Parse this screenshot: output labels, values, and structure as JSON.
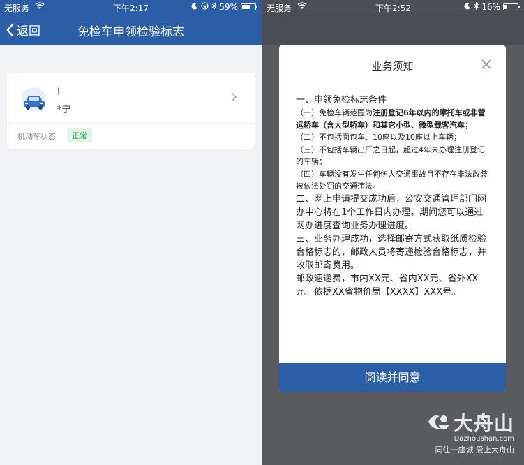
{
  "left": {
    "status_bar": {
      "carrier": "无服务",
      "time": "下午2:17",
      "battery": "59%",
      "battery_level": 0.59
    },
    "nav": {
      "back_label": "返回",
      "title": "免检车申领检验标志"
    },
    "vehicle_card": {
      "plate_line1": "I",
      "plate_line2": "*宁",
      "status_label": "机动车状态",
      "status_value": "正常"
    }
  },
  "right": {
    "status_bar": {
      "carrier": "无服务",
      "time": "下午2:52",
      "battery": "16%",
      "battery_level": 0.16
    },
    "modal": {
      "title": "业务须知",
      "heading1": "一、申领免检标志条件",
      "item1_a": "（一）免检车辆范围为",
      "item1_b": "注册登记6年以内的摩托车或非营运轿车（含大型轿车）和其它小型、微型载客汽车",
      "item1_c": "；",
      "item2": "（二）不包括面包车、10座以及10座以上车辆；",
      "item3": "（三）不包括车辆出厂之日起，超过4年未办理注册登记的车辆；",
      "item4": "（四）车辆没有发生任何伤人交通事故且不存在非法改装被依法处罚的交通违法。",
      "heading2": "二、网上申请提交成功后，公安交通管理部门网办中心将在1个工作日内办理，期间您可以通过网办进度查询业务办理进度。",
      "heading3": "三、业务办理成功，选择邮寄方式获取纸质检验合格标志的，邮政人员将寄递检验合格标志，并收取邮寄费用。",
      "postal_note": "邮政速递费，市内XX元、省内XX元、省外XX元。依据XX省物价局【XXXX】XXX号。",
      "agree_button": "阅读并同意"
    }
  },
  "watermark": {
    "name": "大舟山",
    "domain": "Dazhoushan.com",
    "slogan": "同住一座城 爱上大舟山"
  },
  "colors": {
    "brand_blue": "#2c5ea8",
    "status_green": "#2e9d5f",
    "status_green_bg": "#e3f5ea"
  }
}
